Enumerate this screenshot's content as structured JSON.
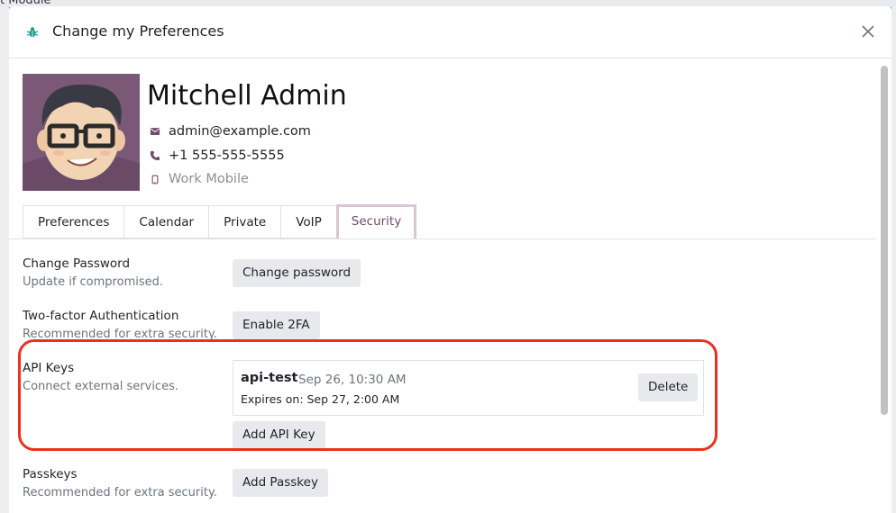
{
  "background": {
    "app_title": "t Module"
  },
  "dialog": {
    "title": "Change my Preferences"
  },
  "user": {
    "name": "Mitchell Admin",
    "email": "admin@example.com",
    "phone": "+1 555-555-5555",
    "mobile_placeholder": "Work Mobile"
  },
  "tabs": [
    {
      "label": "Preferences"
    },
    {
      "label": "Calendar"
    },
    {
      "label": "Private"
    },
    {
      "label": "VoIP"
    },
    {
      "label": "Security",
      "active": true
    }
  ],
  "security": {
    "change_password": {
      "label": "Change Password",
      "help": "Update if compromised.",
      "button": "Change password"
    },
    "two_factor": {
      "label": "Two-factor Authentication",
      "help": "Recommended for extra security.",
      "button": "Enable 2FA"
    },
    "api_keys": {
      "label": "API Keys",
      "help": "Connect external services.",
      "keys": [
        {
          "name": "api-test",
          "created": "Sep 26, 10:30 AM",
          "expires": "Expires on: Sep 27, 2:00 AM",
          "delete_label": "Delete"
        }
      ],
      "add_button": "Add API Key"
    },
    "passkeys": {
      "label": "Passkeys",
      "help": "Recommended for extra security.",
      "button": "Add Passkey"
    }
  },
  "colors": {
    "brand": "#714b67",
    "highlight": "#e8321f",
    "button_bg": "#e7e9ed"
  }
}
